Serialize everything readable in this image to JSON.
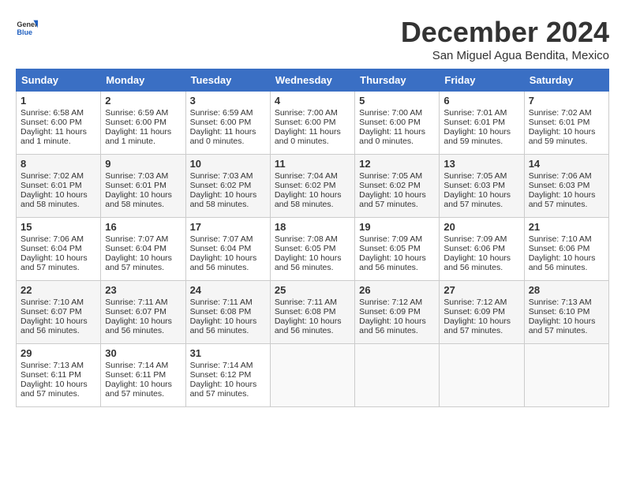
{
  "header": {
    "logo_general": "General",
    "logo_blue": "Blue",
    "month_title": "December 2024",
    "location": "San Miguel Agua Bendita, Mexico"
  },
  "weekdays": [
    "Sunday",
    "Monday",
    "Tuesday",
    "Wednesday",
    "Thursday",
    "Friday",
    "Saturday"
  ],
  "weeks": [
    [
      {
        "day": "1",
        "sunrise": "6:58 AM",
        "sunset": "6:00 PM",
        "daylight": "11 hours and 1 minute."
      },
      {
        "day": "2",
        "sunrise": "6:59 AM",
        "sunset": "6:00 PM",
        "daylight": "11 hours and 1 minute."
      },
      {
        "day": "3",
        "sunrise": "6:59 AM",
        "sunset": "6:00 PM",
        "daylight": "11 hours and 0 minutes."
      },
      {
        "day": "4",
        "sunrise": "7:00 AM",
        "sunset": "6:00 PM",
        "daylight": "11 hours and 0 minutes."
      },
      {
        "day": "5",
        "sunrise": "7:00 AM",
        "sunset": "6:00 PM",
        "daylight": "11 hours and 0 minutes."
      },
      {
        "day": "6",
        "sunrise": "7:01 AM",
        "sunset": "6:01 PM",
        "daylight": "10 hours and 59 minutes."
      },
      {
        "day": "7",
        "sunrise": "7:02 AM",
        "sunset": "6:01 PM",
        "daylight": "10 hours and 59 minutes."
      }
    ],
    [
      {
        "day": "8",
        "sunrise": "7:02 AM",
        "sunset": "6:01 PM",
        "daylight": "10 hours and 58 minutes."
      },
      {
        "day": "9",
        "sunrise": "7:03 AM",
        "sunset": "6:01 PM",
        "daylight": "10 hours and 58 minutes."
      },
      {
        "day": "10",
        "sunrise": "7:03 AM",
        "sunset": "6:02 PM",
        "daylight": "10 hours and 58 minutes."
      },
      {
        "day": "11",
        "sunrise": "7:04 AM",
        "sunset": "6:02 PM",
        "daylight": "10 hours and 58 minutes."
      },
      {
        "day": "12",
        "sunrise": "7:05 AM",
        "sunset": "6:02 PM",
        "daylight": "10 hours and 57 minutes."
      },
      {
        "day": "13",
        "sunrise": "7:05 AM",
        "sunset": "6:03 PM",
        "daylight": "10 hours and 57 minutes."
      },
      {
        "day": "14",
        "sunrise": "7:06 AM",
        "sunset": "6:03 PM",
        "daylight": "10 hours and 57 minutes."
      }
    ],
    [
      {
        "day": "15",
        "sunrise": "7:06 AM",
        "sunset": "6:04 PM",
        "daylight": "10 hours and 57 minutes."
      },
      {
        "day": "16",
        "sunrise": "7:07 AM",
        "sunset": "6:04 PM",
        "daylight": "10 hours and 57 minutes."
      },
      {
        "day": "17",
        "sunrise": "7:07 AM",
        "sunset": "6:04 PM",
        "daylight": "10 hours and 56 minutes."
      },
      {
        "day": "18",
        "sunrise": "7:08 AM",
        "sunset": "6:05 PM",
        "daylight": "10 hours and 56 minutes."
      },
      {
        "day": "19",
        "sunrise": "7:09 AM",
        "sunset": "6:05 PM",
        "daylight": "10 hours and 56 minutes."
      },
      {
        "day": "20",
        "sunrise": "7:09 AM",
        "sunset": "6:06 PM",
        "daylight": "10 hours and 56 minutes."
      },
      {
        "day": "21",
        "sunrise": "7:10 AM",
        "sunset": "6:06 PM",
        "daylight": "10 hours and 56 minutes."
      }
    ],
    [
      {
        "day": "22",
        "sunrise": "7:10 AM",
        "sunset": "6:07 PM",
        "daylight": "10 hours and 56 minutes."
      },
      {
        "day": "23",
        "sunrise": "7:11 AM",
        "sunset": "6:07 PM",
        "daylight": "10 hours and 56 minutes."
      },
      {
        "day": "24",
        "sunrise": "7:11 AM",
        "sunset": "6:08 PM",
        "daylight": "10 hours and 56 minutes."
      },
      {
        "day": "25",
        "sunrise": "7:11 AM",
        "sunset": "6:08 PM",
        "daylight": "10 hours and 56 minutes."
      },
      {
        "day": "26",
        "sunrise": "7:12 AM",
        "sunset": "6:09 PM",
        "daylight": "10 hours and 56 minutes."
      },
      {
        "day": "27",
        "sunrise": "7:12 AM",
        "sunset": "6:09 PM",
        "daylight": "10 hours and 57 minutes."
      },
      {
        "day": "28",
        "sunrise": "7:13 AM",
        "sunset": "6:10 PM",
        "daylight": "10 hours and 57 minutes."
      }
    ],
    [
      {
        "day": "29",
        "sunrise": "7:13 AM",
        "sunset": "6:11 PM",
        "daylight": "10 hours and 57 minutes."
      },
      {
        "day": "30",
        "sunrise": "7:14 AM",
        "sunset": "6:11 PM",
        "daylight": "10 hours and 57 minutes."
      },
      {
        "day": "31",
        "sunrise": "7:14 AM",
        "sunset": "6:12 PM",
        "daylight": "10 hours and 57 minutes."
      },
      null,
      null,
      null,
      null
    ]
  ]
}
